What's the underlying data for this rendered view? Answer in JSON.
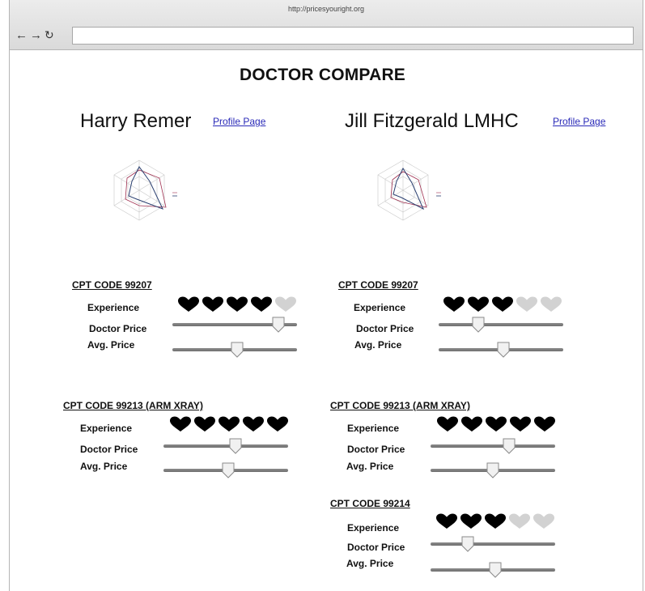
{
  "browser": {
    "title": "http://pricesyouright.org",
    "back_icon": "←",
    "forward_icon": "→",
    "reload_icon": "↻",
    "url_value": ""
  },
  "page": {
    "title": "DOCTOR COMPARE"
  },
  "labels": {
    "experience": "Experience",
    "doctor_price": "Doctor Price",
    "avg_price": "Avg. Price"
  },
  "colors": {
    "heart_filled": "#000000",
    "heart_empty": "#d2d2d2",
    "link": "#2a2ab8"
  },
  "doctors": [
    {
      "name": "Harry Remer",
      "profile_link": "Profile Page",
      "cpts": [
        {
          "code": "CPT CODE 99207",
          "experience_filled": 4,
          "experience_total": 5,
          "doctor_price_pct": 0.85,
          "avg_price_pct": 0.52
        },
        {
          "code": "CPT CODE 99213 (ARM XRAY)",
          "experience_filled": 5,
          "experience_total": 5,
          "doctor_price_pct": 0.58,
          "avg_price_pct": 0.52
        }
      ]
    },
    {
      "name": "Jill Fitzgerald LMHC",
      "profile_link": "Profile Page",
      "cpts": [
        {
          "code": "CPT CODE 99207",
          "experience_filled": 3,
          "experience_total": 5,
          "doctor_price_pct": 0.32,
          "avg_price_pct": 0.52
        },
        {
          "code": "CPT CODE 99213 (ARM XRAY)",
          "experience_filled": 5,
          "experience_total": 5,
          "doctor_price_pct": 0.63,
          "avg_price_pct": 0.5
        },
        {
          "code": "CPT CODE 99214",
          "experience_filled": 3,
          "experience_total": 5,
          "doctor_price_pct": 0.3,
          "avg_price_pct": 0.52
        }
      ]
    }
  ]
}
